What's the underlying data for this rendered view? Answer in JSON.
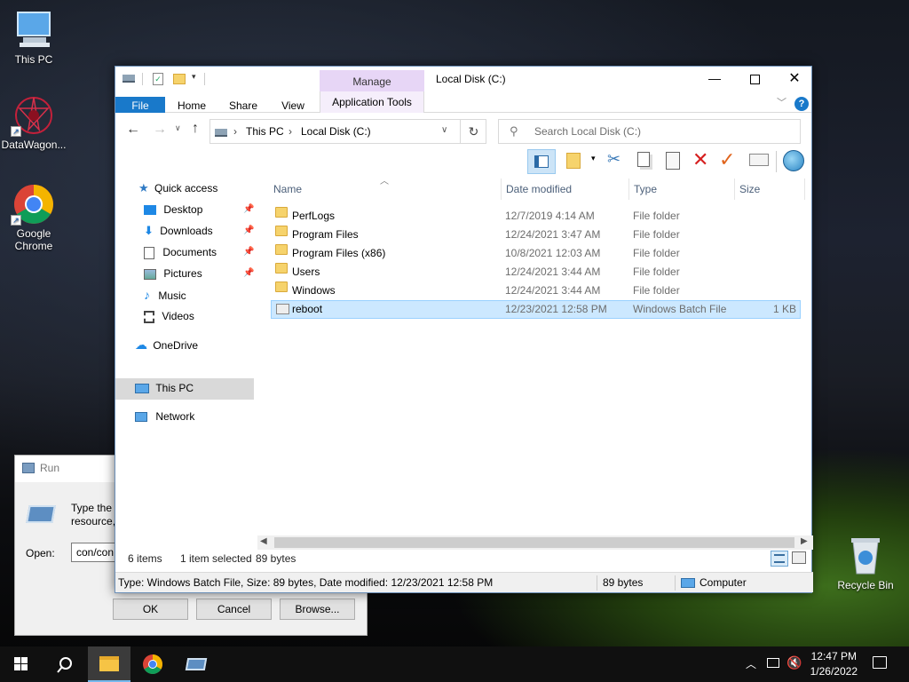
{
  "desktop": {
    "icons": [
      {
        "label": "This PC",
        "icon": "this-pc-icon"
      },
      {
        "label": "DataWagon...",
        "icon": "datawagon-icon"
      },
      {
        "label": "Google Chrome",
        "icon": "chrome-icon"
      },
      {
        "label": "Recycle Bin",
        "icon": "recycle-bin-icon"
      }
    ]
  },
  "run_dialog": {
    "title": "Run",
    "description_line1": "Type the r",
    "description_line2": "resource, ",
    "open_label": "Open:",
    "open_value": "con/con",
    "ok_label": "OK",
    "cancel_label": "Cancel",
    "browse_label": "Browse..."
  },
  "explorer": {
    "title": "Local Disk (C:)",
    "context_tab_group": "Manage",
    "tabs": {
      "file": "File",
      "home": "Home",
      "share": "Share",
      "view": "View",
      "app_tools": "Application Tools"
    },
    "breadcrumb": [
      "This PC",
      "Local Disk (C:)"
    ],
    "search_placeholder": "Search Local Disk (C:)",
    "nav": {
      "quick_access": "Quick access",
      "desktop": "Desktop",
      "downloads": "Downloads",
      "documents": "Documents",
      "pictures": "Pictures",
      "music": "Music",
      "videos": "Videos",
      "onedrive": "OneDrive",
      "this_pc": "This PC",
      "network": "Network"
    },
    "columns": {
      "name": "Name",
      "date": "Date modified",
      "type": "Type",
      "size": "Size"
    },
    "files": [
      {
        "name": "PerfLogs",
        "date": "12/7/2019 4:14 AM",
        "type": "File folder",
        "size": ""
      },
      {
        "name": "Program Files",
        "date": "12/24/2021 3:47 AM",
        "type": "File folder",
        "size": ""
      },
      {
        "name": "Program Files (x86)",
        "date": "10/8/2021 12:03 AM",
        "type": "File folder",
        "size": ""
      },
      {
        "name": "Users",
        "date": "12/24/2021 3:44 AM",
        "type": "File folder",
        "size": ""
      },
      {
        "name": "Windows",
        "date": "12/24/2021 3:44 AM",
        "type": "File folder",
        "size": ""
      },
      {
        "name": "reboot",
        "date": "12/23/2021 12:58 PM",
        "type": "Windows Batch File",
        "size": "1 KB"
      }
    ],
    "status": {
      "items": "6 items",
      "selected": "1 item selected",
      "selected_size": "89 bytes"
    },
    "details_bar": {
      "info": "Type: Windows Batch File, Size: 89 bytes, Date modified: 12/23/2021 12:58 PM",
      "size": "89 bytes",
      "location": "Computer"
    }
  },
  "taskbar": {
    "time": "12:47 PM",
    "date": "1/26/2022"
  }
}
